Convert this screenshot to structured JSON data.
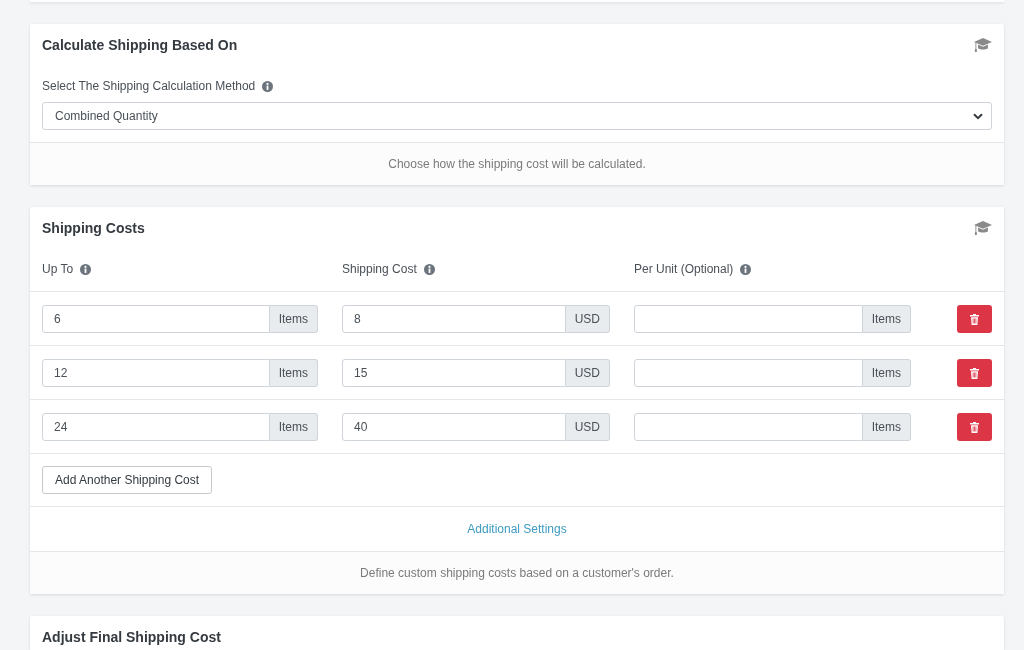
{
  "calculation_card": {
    "title": "Calculate Shipping Based On",
    "method_label": "Select The Shipping Calculation Method",
    "method_select": {
      "value": "Combined Quantity"
    },
    "help_text": "Choose how the shipping cost will be calculated."
  },
  "shipping_costs_card": {
    "title": "Shipping Costs",
    "columns": [
      "Up To",
      "Shipping Cost",
      "Per Unit (Optional)"
    ],
    "rows": [
      {
        "cells": [
          {
            "value": "6",
            "unit": "Items"
          },
          {
            "value": "8",
            "unit": "USD"
          },
          {
            "unit": "Items"
          }
        ]
      },
      {
        "cells": [
          {
            "value": "12",
            "unit": "Items"
          },
          {
            "value": "15",
            "unit": "USD"
          },
          {
            "unit": "Items"
          }
        ]
      },
      {
        "cells": [
          {
            "value": "24",
            "unit": "Items"
          },
          {
            "value": "40",
            "unit": "USD"
          },
          {
            "unit": "Items"
          }
        ]
      }
    ],
    "add_button": "Add Another Shipping Cost",
    "settings_link": "Additional Settings",
    "help_text": "Define custom shipping costs based on a customer's order."
  },
  "final_cost_card": {
    "title": "Adjust Final Shipping Cost"
  }
}
